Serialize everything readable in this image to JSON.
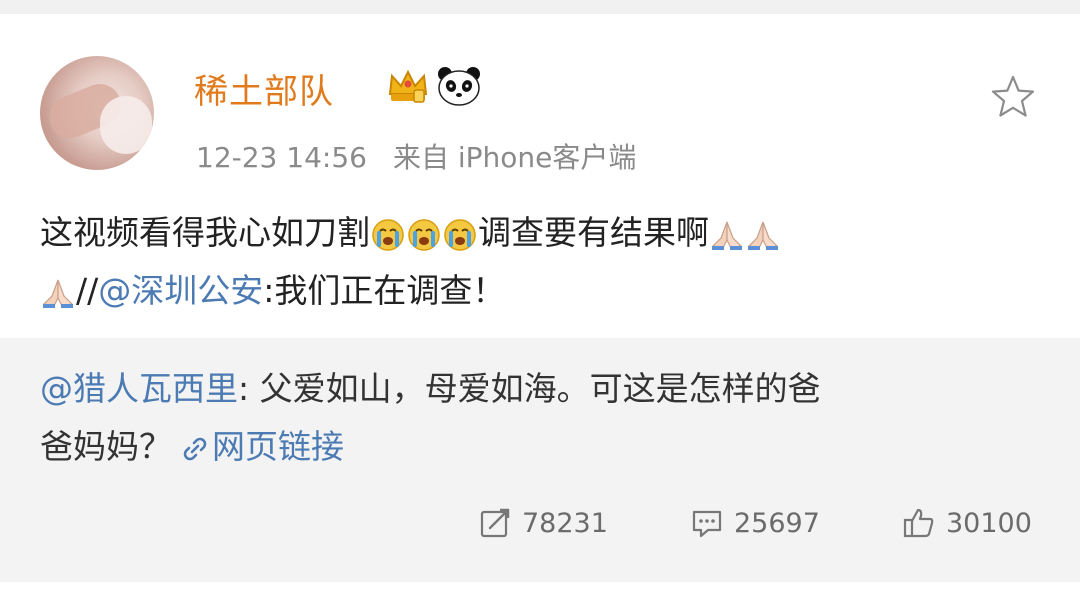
{
  "post": {
    "username": "稀土部队",
    "badges": [
      "crown-icon",
      "panda-icon"
    ],
    "time": "12-23 14:56",
    "source": "来自 iPhone客户端",
    "text_line1_a": "这视频看得我心如刀割",
    "text_line1_b": "调查要有结果啊",
    "text_line2_sep": "//",
    "repost_author": "@深圳公安",
    "repost_comment": ":我们正在调查！",
    "emojis": [
      "crying-emoji",
      "praying-hands-emoji"
    ]
  },
  "original": {
    "author": "@猎人瓦西里",
    "text_line1": ": 父爱如山，母爱如海。可这是怎样的爸",
    "text_line2": "爸妈妈？",
    "link_label": "网页链接"
  },
  "actions": {
    "repost_count": "78231",
    "comment_count": "25697",
    "like_count": "30100"
  },
  "colors": {
    "username": "#e07a1c",
    "mention": "#4c7bb4",
    "meta": "#8a8a8a",
    "repost_bg": "#f3f3f3"
  }
}
